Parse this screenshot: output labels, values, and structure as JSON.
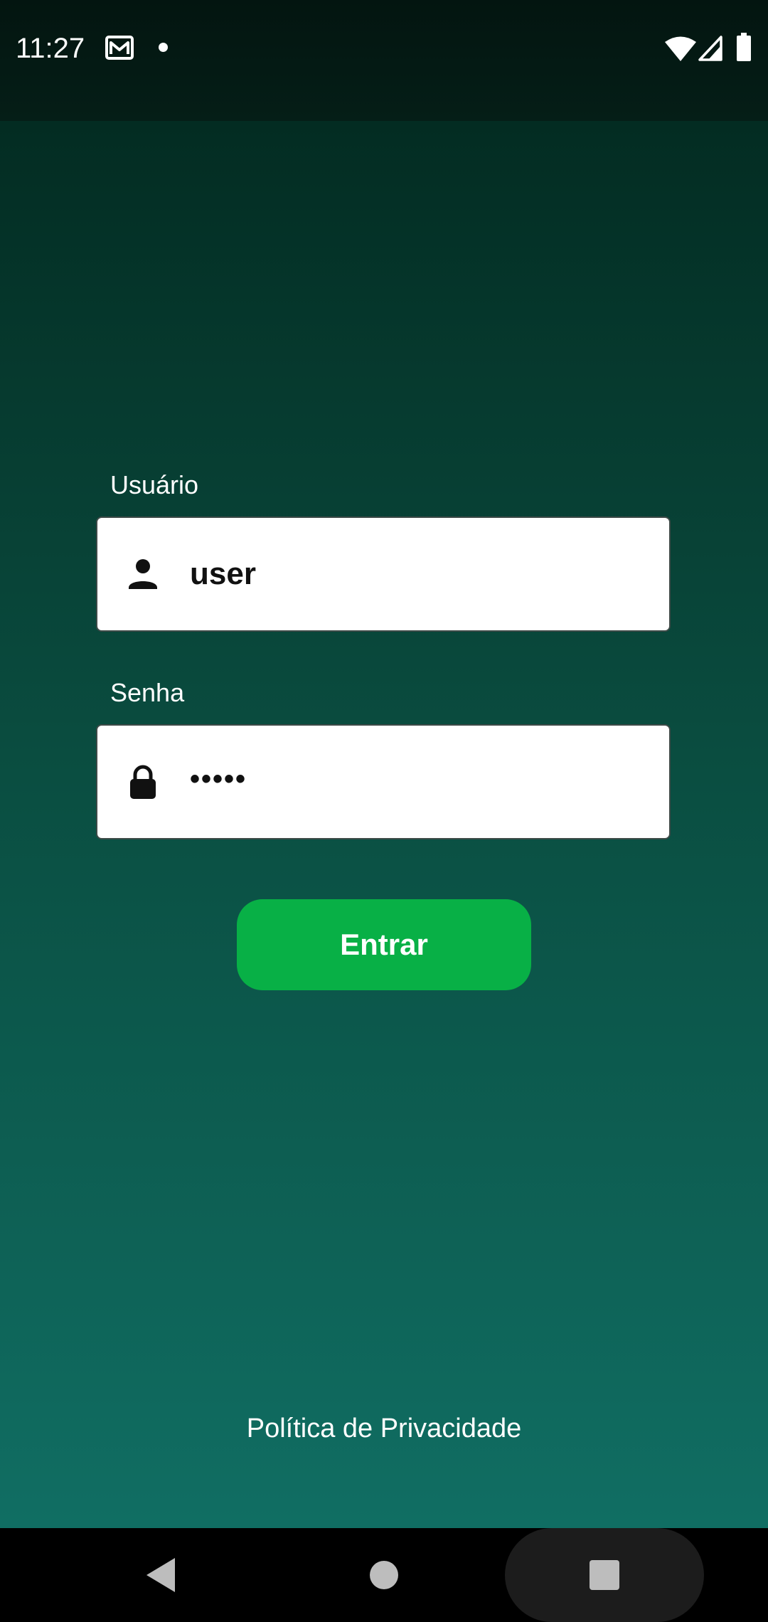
{
  "status_bar": {
    "time": "11:27",
    "icons": [
      "mail-icon",
      "notification-dot-icon",
      "wifi-icon",
      "signal-icon",
      "battery-icon"
    ]
  },
  "login_form": {
    "username": {
      "label": "Usuário",
      "value": "user",
      "icon": "person-icon"
    },
    "password": {
      "label": "Senha",
      "value": "•••••",
      "icon": "lock-icon"
    },
    "submit_label": "Entrar"
  },
  "footer": {
    "privacy_label": "Política de Privacidade"
  },
  "nav_bar": {
    "icons": [
      "back-icon",
      "home-icon",
      "recents-icon"
    ]
  },
  "colors": {
    "background_top": "#032c22",
    "background_bottom": "#106e63",
    "button": "#08b046",
    "input_background": "#ffffff",
    "text_light": "#ffffff"
  }
}
